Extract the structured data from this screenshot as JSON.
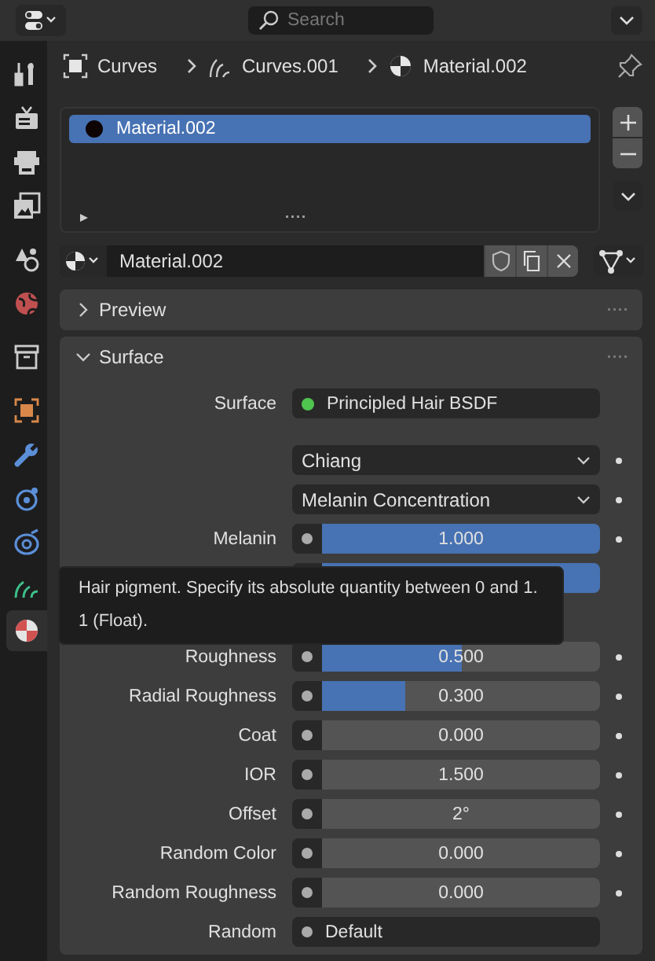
{
  "search": {
    "placeholder": "Search"
  },
  "sidebar": {
    "tabs": [
      {
        "selected": false
      },
      {
        "selected": false
      },
      {
        "selected": false
      },
      {
        "selected": false
      },
      {
        "selected": false
      },
      {
        "selected": false
      },
      {
        "selected": false
      },
      {
        "selected": false
      },
      {
        "selected": false
      },
      {
        "selected": false
      },
      {
        "selected": false
      },
      {
        "selected": false
      },
      {
        "selected": true
      }
    ]
  },
  "breadcrumb": [
    "Curves",
    "Curves.001",
    "Material.002"
  ],
  "material_slots": [
    {
      "name": "Material.002",
      "selected": true
    }
  ],
  "material_selector": {
    "value": "Material.002"
  },
  "panels": [
    {
      "title": "Preview",
      "expanded": false
    },
    {
      "title": "Surface",
      "expanded": true
    }
  ],
  "surface": {
    "label": "Surface",
    "value": "Principled Hair BSDF"
  },
  "rows": [
    {
      "kind": "dropdown",
      "value": "Chiang"
    },
    {
      "kind": "dropdown",
      "value": "Melanin Concentration"
    },
    {
      "kind": "slider",
      "label": "Melanin",
      "value": "1.000",
      "level": 1
    },
    {
      "kind": "covered",
      "level": 1
    },
    {
      "kind": "slider",
      "label": "Roughness",
      "value": "0.500",
      "level": 0.5
    },
    {
      "kind": "slider",
      "label": "Radial Roughness",
      "value": "0.300",
      "level": 0.3
    },
    {
      "kind": "slider",
      "label": "Coat",
      "value": "0.000",
      "level": 0
    },
    {
      "kind": "slider",
      "label": "IOR",
      "value": "1.500",
      "level": 0
    },
    {
      "kind": "slider",
      "label": "Offset",
      "value": "2°",
      "level": 0
    },
    {
      "kind": "slider",
      "label": "Random Color",
      "value": "0.000",
      "level": 0
    },
    {
      "kind": "slider",
      "label": "Random Roughness",
      "value": "0.000",
      "level": 0
    },
    {
      "kind": "field",
      "label": "Random",
      "value": "Default"
    }
  ],
  "tooltip": {
    "lines": [
      "Hair pigment. Specify its absolute quantity between 0 and 1.",
      "1 (Float)."
    ]
  }
}
